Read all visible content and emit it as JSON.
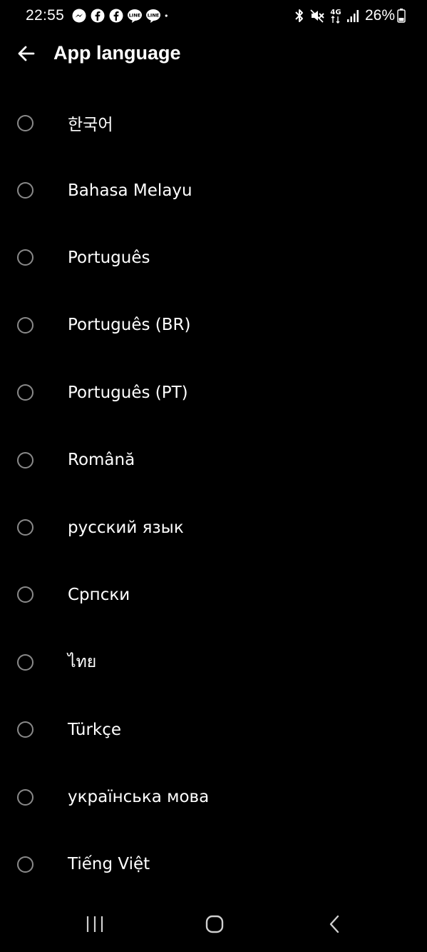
{
  "status_bar": {
    "time": "22:55",
    "battery": "26%",
    "notification_icons": [
      "messenger-icon",
      "facebook-icon",
      "facebook-icon",
      "line-icon",
      "line-icon",
      "dot-icon"
    ],
    "system_icons": [
      "bluetooth-icon",
      "mute-icon",
      "network-4g-icon",
      "signal-icon",
      "battery-icon"
    ],
    "network_label": "4G"
  },
  "app_bar": {
    "title": "App language",
    "back_icon": "arrow-left-icon"
  },
  "languages": [
    {
      "label": "한국어",
      "selected": false
    },
    {
      "label": "Bahasa Melayu",
      "selected": false
    },
    {
      "label": "Português",
      "selected": false
    },
    {
      "label": "Português (BR)",
      "selected": false
    },
    {
      "label": "Português (PT)",
      "selected": false
    },
    {
      "label": "Română",
      "selected": false
    },
    {
      "label": "русский язык",
      "selected": false
    },
    {
      "label": "Српски",
      "selected": false
    },
    {
      "label": "ไทย",
      "selected": false
    },
    {
      "label": "Türkçe",
      "selected": false
    },
    {
      "label": "українська мова",
      "selected": false
    },
    {
      "label": "Tiếng Việt",
      "selected": false
    }
  ],
  "nav_bar": {
    "recents_icon": "recents-icon",
    "home_icon": "home-icon",
    "back_icon": "back-chevron-icon"
  },
  "colors": {
    "background": "#000000",
    "text": "#ffffff",
    "radio_border": "#8a8a8a"
  }
}
